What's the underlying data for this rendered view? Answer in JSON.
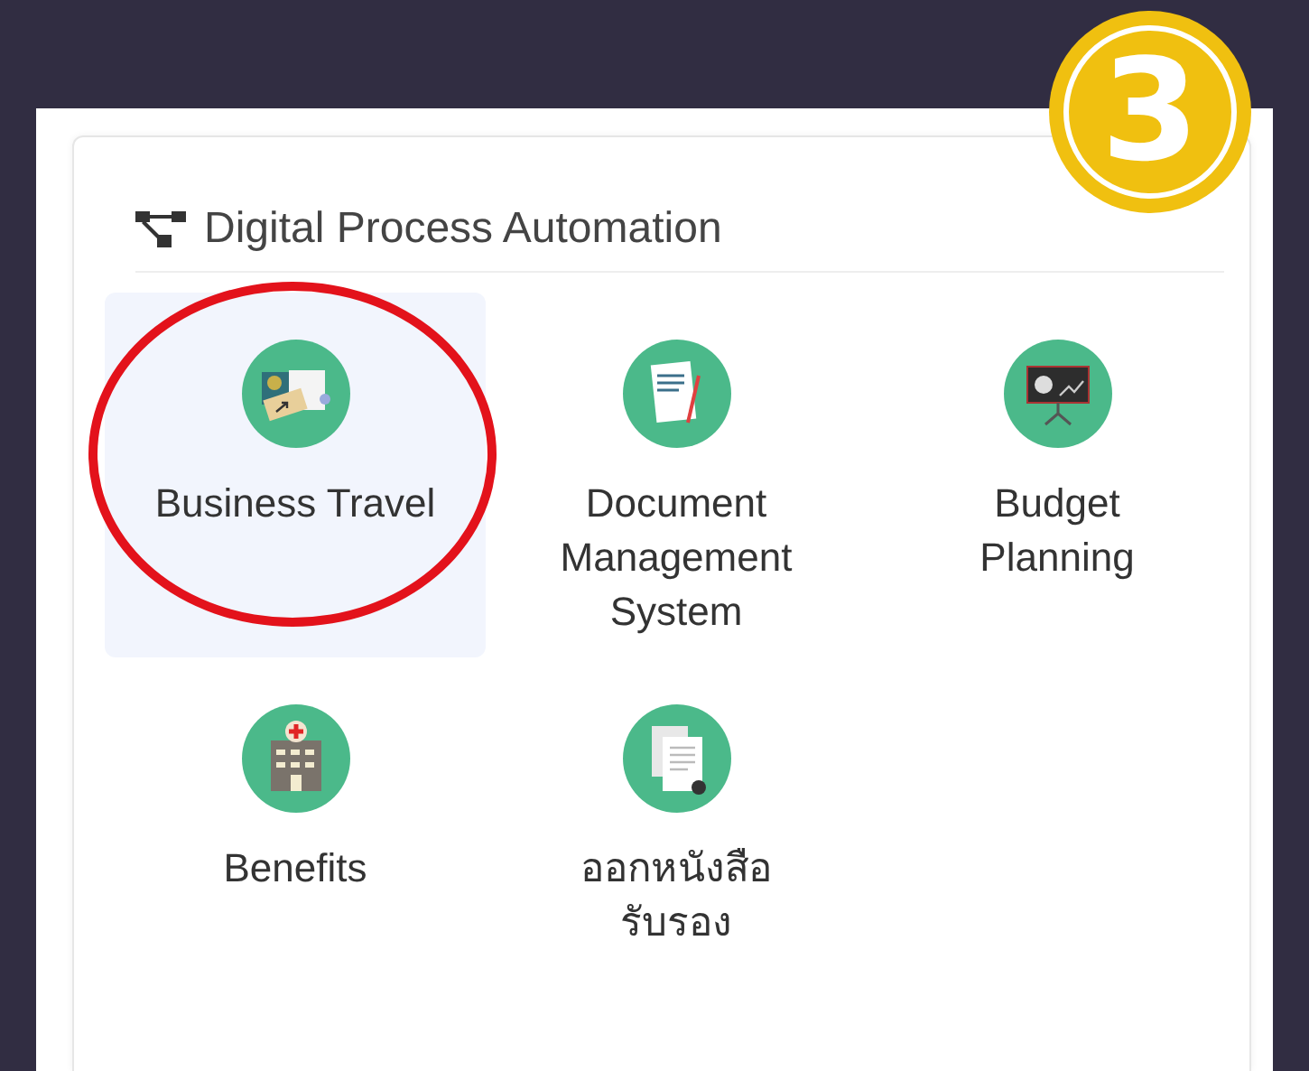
{
  "step_badge": "3",
  "card": {
    "title": "Digital Process Automation",
    "apps": [
      {
        "label": "Business Travel",
        "kind": "travel",
        "selected": true,
        "circled": true
      },
      {
        "label": "Document Management System",
        "kind": "document",
        "selected": false,
        "circled": false
      },
      {
        "label": "Budget Planning",
        "kind": "presentation",
        "selected": false,
        "circled": false
      },
      {
        "label": "Benefits",
        "kind": "hospital",
        "selected": false,
        "circled": false
      },
      {
        "label": "ออกหนังสือรับรอง",
        "kind": "certificate",
        "selected": false,
        "circled": false
      }
    ]
  }
}
